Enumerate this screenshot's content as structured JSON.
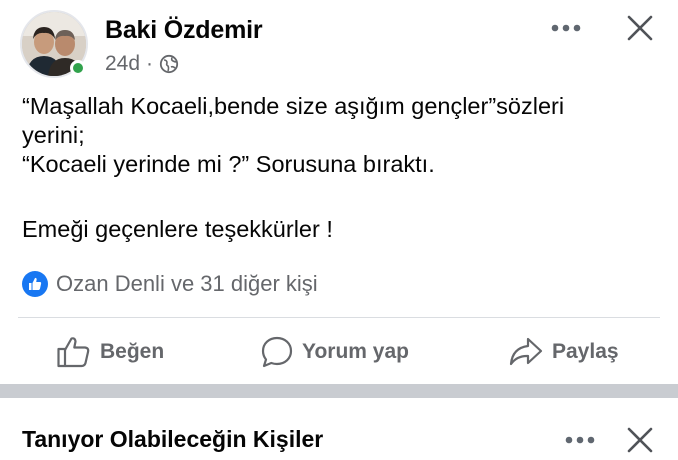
{
  "post": {
    "author": {
      "name": "Baki Özdemir",
      "online": true
    },
    "timestamp": "24d",
    "separator": "·",
    "audience_icon": "globe-icon",
    "text_lines": [
      "“Maşallah Kocaeli,bende size aşığım gençler”sözleri\nyerini;\n“Kocaeli yerinde mi ?” Sorusuna bıraktı.",
      "Emeği geçenlere teşekkürler !"
    ],
    "reactions": {
      "icon": "thumbs-up-icon",
      "text": "Ozan Denli ve 31 diğer kişi"
    },
    "actions": {
      "like_label": "Beğen",
      "comment_label": "Yorum yap",
      "share_label": "Paylaş"
    }
  },
  "suggestions_card": {
    "title": "Tanıyor Olabileceğin Kişiler"
  },
  "colors": {
    "accent": "#1877f2",
    "online": "#31a24c",
    "secondary_text": "#65676b",
    "separator": "#c9ccd1"
  }
}
